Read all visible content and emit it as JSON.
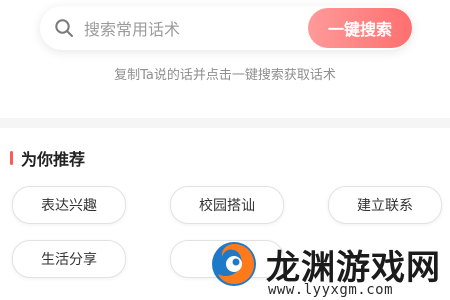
{
  "search": {
    "placeholder": "搜索常用话术",
    "button_label": "一键搜索",
    "icon": "search-icon",
    "hint": "复制Ta说的话并点击一键搜索获取话术"
  },
  "recommend": {
    "title": "为你推荐",
    "chips": [
      "表达兴趣",
      "校园搭讪",
      "建立联系",
      "生活分享",
      ""
    ]
  },
  "watermark": {
    "title": "龙渊游戏网",
    "url": "www.lyyxgm.com"
  },
  "colors": {
    "accent": "#ff6f6f",
    "title_bar": "#ff5a5a",
    "hint_text": "#8f8f8f",
    "divider": "#f5f5f5"
  }
}
